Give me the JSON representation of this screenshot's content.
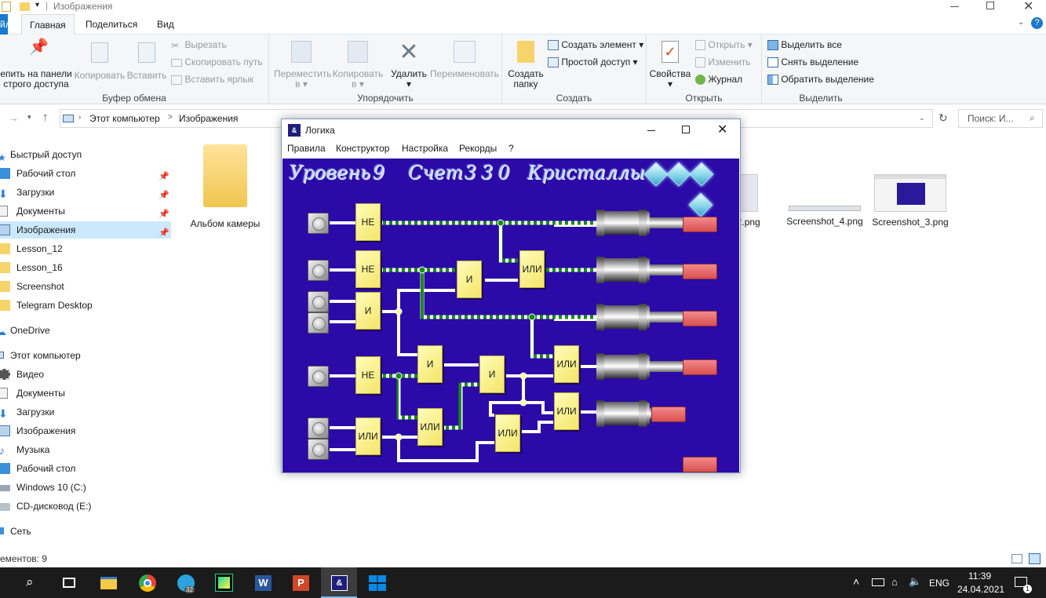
{
  "explorer": {
    "title": "Изображения",
    "tabs": [
      "йл",
      "Главная",
      "Поделиться",
      "Вид"
    ],
    "ribbon": {
      "clipboard": {
        "pin_label_1": "епить на панели",
        "pin_label_2": "строго доступа",
        "copy": "Копировать",
        "paste": "Вставить",
        "cut": "Вырезать",
        "copy_path": "Скопировать путь",
        "paste_shortcut": "Вставить ярлык",
        "group": "Буфер обмена"
      },
      "organize": {
        "move": "Переместить",
        "move_sub": "в ▾",
        "copyto": "Копировать",
        "copyto_sub": "в ▾",
        "delete": "Удалить",
        "delete_sub": "▾",
        "rename": "Переименовать",
        "group": "Упорядочить"
      },
      "create": {
        "new_folder_1": "Создать",
        "new_folder_2": "папку",
        "new_item": "Создать элемент ▾",
        "easy_access": "Простой доступ ▾",
        "group": "Создать"
      },
      "open": {
        "properties": "Свойства",
        "properties_sub": "▾",
        "open": "Открыть ▾",
        "edit": "Изменить",
        "history": "Журнал",
        "group": "Открыть"
      },
      "select": {
        "select_all": "Выделить все",
        "select_none": "Снять выделение",
        "invert": "Обратить выделение",
        "group": "Выделить"
      }
    },
    "address": {
      "crumb1": "Этот компьютер",
      "sep": ">",
      "crumb2": "Изображения",
      "search_placeholder": "Поиск: И..."
    },
    "nav": [
      {
        "label": "Быстрый доступ",
        "icon": "star-icon"
      },
      {
        "label": "Рабочий стол",
        "icon": "desktop-icon"
      },
      {
        "label": "Загрузки",
        "icon": "download-icon"
      },
      {
        "label": "Документы",
        "icon": "documents-icon"
      },
      {
        "label": "Изображения",
        "icon": "pictures-icon"
      },
      {
        "label": "Lesson_12",
        "icon": "folder-icon"
      },
      {
        "label": "Lesson_16",
        "icon": "folder-icon"
      },
      {
        "label": "Screenshot",
        "icon": "folder-icon"
      },
      {
        "label": "Telegram Desktop",
        "icon": "folder-icon"
      },
      {
        "label": "OneDrive",
        "icon": "cloud-icon"
      },
      {
        "label": "Этот компьютер",
        "icon": "computer-icon"
      },
      {
        "label": "Видео",
        "icon": "video-icon"
      },
      {
        "label": "Документы",
        "icon": "documents-icon"
      },
      {
        "label": "Загрузки",
        "icon": "download-icon"
      },
      {
        "label": "Изображения",
        "icon": "pictures-icon"
      },
      {
        "label": "Музыка",
        "icon": "music-icon"
      },
      {
        "label": "Рабочий стол",
        "icon": "desktop-icon"
      },
      {
        "label": "Windows 10 (C:)",
        "icon": "drive-icon"
      },
      {
        "label": "CD-дисковод (E:)",
        "icon": "cd-icon"
      },
      {
        "label": "Сеть",
        "icon": "network-icon"
      }
    ],
    "files": [
      "Альбом камеры",
      "ot_2.png",
      "Screenshot_4.png",
      "Screenshot_3.png"
    ],
    "status": "ементов: 9"
  },
  "game": {
    "title": "Логика",
    "menu": [
      "Правила",
      "Конструктор",
      "Настройка",
      "Рекорды",
      "?"
    ],
    "hud": {
      "level_label": "Уровень",
      "level": "9",
      "score_label": "Счет",
      "score": "330",
      "crystals_label": "Кристаллы",
      "crystals": 3
    },
    "gates": {
      "not1": "НЕ",
      "not2": "НЕ",
      "not3": "НЕ",
      "and1": "И",
      "and2": "И",
      "and3": "И",
      "and4": "И",
      "or1": "ИЛИ",
      "or2": "ИЛИ",
      "or3": "ИЛИ",
      "or4": "ИЛИ",
      "or5": "ИЛИ",
      "or6": "ИЛИ"
    },
    "colors": {
      "board": "#2b0aa8",
      "lamp": "#e06060",
      "gate": "#f7ec8a",
      "active_wire": "#1a8a1a"
    }
  },
  "taskbar": {
    "apps": [
      "search-icon",
      "task-view-icon",
      "explorer-icon",
      "chrome-icon",
      "telegram-icon",
      "pycharm-icon",
      "word-icon",
      "powerpoint-icon",
      "logika-icon",
      "windows-icon"
    ],
    "telegram_badge": "32",
    "lang": "ENG",
    "time": "11:39",
    "date": "24.04.2021",
    "notify_count": "1"
  }
}
